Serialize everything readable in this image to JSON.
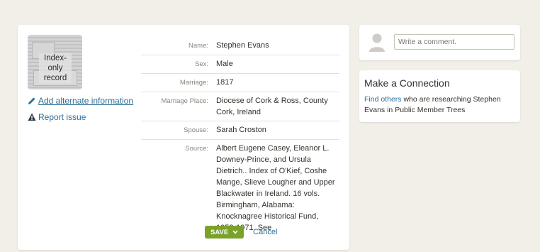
{
  "record": {
    "thumbnail_label": "Index-only record",
    "add_alternate_label": "Add alternate information",
    "report_issue_label": "Report issue",
    "fields": [
      {
        "label": "Name:",
        "value": "Stephen Evans"
      },
      {
        "label": "Sex:",
        "value": "Male"
      },
      {
        "label": "Marriage:",
        "value": "1817"
      },
      {
        "label": "Marriage Place:",
        "value": "Diocese of Cork & Ross, County Cork, Ireland"
      },
      {
        "label": "Spouse:",
        "value": "Sarah Croston"
      },
      {
        "label": "Source:",
        "value": "Albert Eugene Casey, Eleanor L. Downey-Prince, and Ursula Dietrich.. Index of O'Kief, Coshe Mange, Slieve Lougher and Upper Blackwater in Ireland. 16 vols. Birmingham, Alabama: Knocknagree Historical Fund, 1952-1971. See"
      }
    ],
    "save_label": "SAVE",
    "cancel_label": "Cancel"
  },
  "comment": {
    "placeholder": "Write a comment."
  },
  "connection": {
    "title": "Make a Connection",
    "link_text": "Find others",
    "text": " who are researching Stephen Evans in Public Member Trees"
  },
  "colors": {
    "background": "#f2efe9",
    "accent_green": "#7aa228",
    "link_blue": "#2a6f97"
  }
}
